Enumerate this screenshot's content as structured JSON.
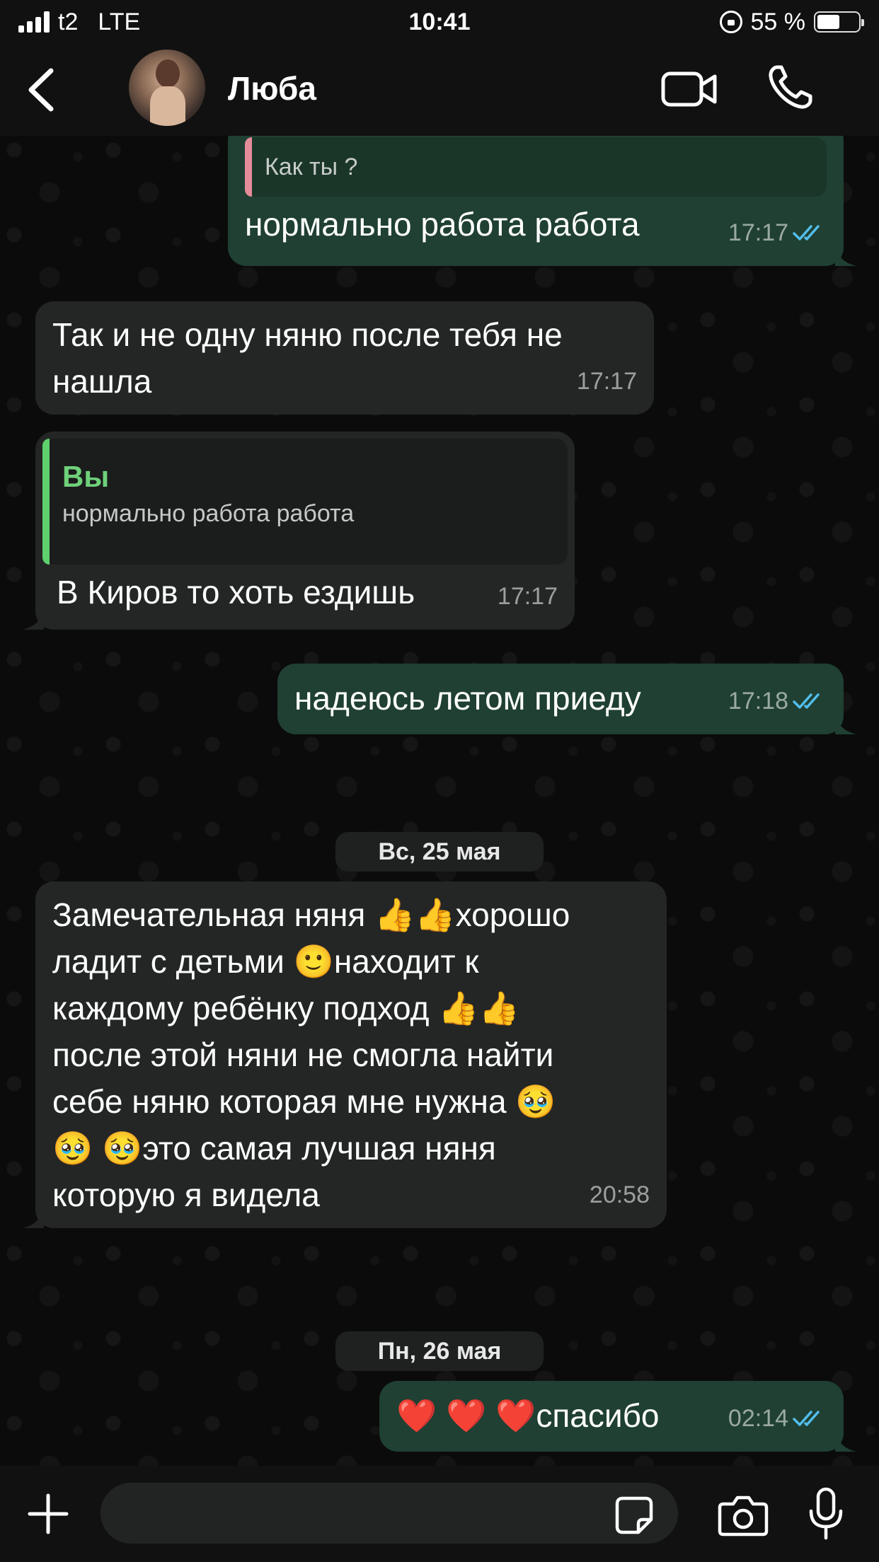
{
  "status_bar": {
    "carrier": "t2",
    "network": "LTE",
    "time": "10:41",
    "battery": "55 %",
    "battery_level": 0.55,
    "icons": [
      "signal-icon",
      "orientation-lock-icon",
      "battery-icon"
    ]
  },
  "header": {
    "contact_name": "Люба",
    "icons": [
      "back-arrow-icon",
      "video-camera-icon",
      "phone-icon"
    ]
  },
  "messages": [
    {
      "direction": "out",
      "quote_text": "Как ты ?",
      "text": "нормально работа работа",
      "time": "17:17",
      "read": true
    },
    {
      "direction": "in",
      "text_line1": "Так и не одну няню после тебя не",
      "text_line2": "нашла",
      "time": "17:17"
    },
    {
      "direction": "in",
      "quote_author": "Вы",
      "quote_text": "нормально работа работа",
      "text": "В Киров то хоть ездишь",
      "time": "17:17"
    },
    {
      "direction": "out",
      "text": "надеюсь летом приеду",
      "time": "17:18",
      "read": true
    },
    {
      "direction": "in",
      "lines": [
        "Замечательная няня 👍👍хорошо",
        "ладит с детьми 🙂находит к",
        "каждому ребёнку подход 👍👍",
        "после этой няни не смогла найти",
        "себе няню которая мне нужна 🥹",
        "🥹 🥹это самая лучшая няня",
        "которую я видела"
      ],
      "time": "20:58"
    },
    {
      "direction": "out",
      "text": "❤️ ❤️ ❤️спасибо",
      "time": "02:14",
      "read": true
    }
  ],
  "date_separators": {
    "first": "Вс, 25 мая",
    "second": "Пн, 26 мая"
  },
  "input_bar": {
    "placeholder": "",
    "icons": [
      "plus-icon",
      "sticker-icon",
      "camera-icon",
      "microphone-icon"
    ]
  },
  "colors": {
    "outgoing_bubble": "#1f4032",
    "incoming_bubble": "#242626",
    "read_ticks": "#53bdeb",
    "quote_author": "#6fd17a",
    "quote_bar_pink": "#e58c9a",
    "quote_bar_green": "#5fd16c"
  }
}
